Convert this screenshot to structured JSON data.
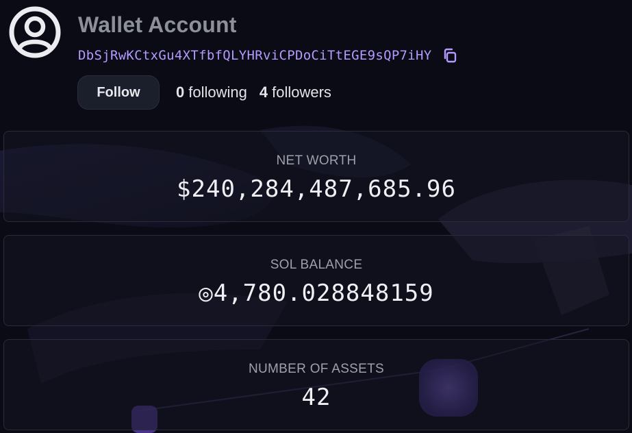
{
  "profile": {
    "title": "Wallet Account",
    "address": "DbSjRwKCtxGu4XTfbfQLYHRviCPDoCiTtEGE9sQP7iHY",
    "follow_label": "Follow",
    "following_count": "0",
    "following_label": "following",
    "followers_count": "4",
    "followers_label": "followers"
  },
  "cards": [
    {
      "label": "NET WORTH",
      "value": "$240,284,487,685.96"
    },
    {
      "label": "SOL BALANCE",
      "value": "◎4,780.028848159"
    },
    {
      "label": "NUMBER OF ASSETS",
      "value": "42"
    }
  ],
  "icons": {
    "avatar": "user-circle-icon",
    "copy": "copy-icon"
  },
  "colors": {
    "background": "#0a0b14",
    "address": "#b49bff",
    "accent_purple": "#6b4fb0"
  }
}
